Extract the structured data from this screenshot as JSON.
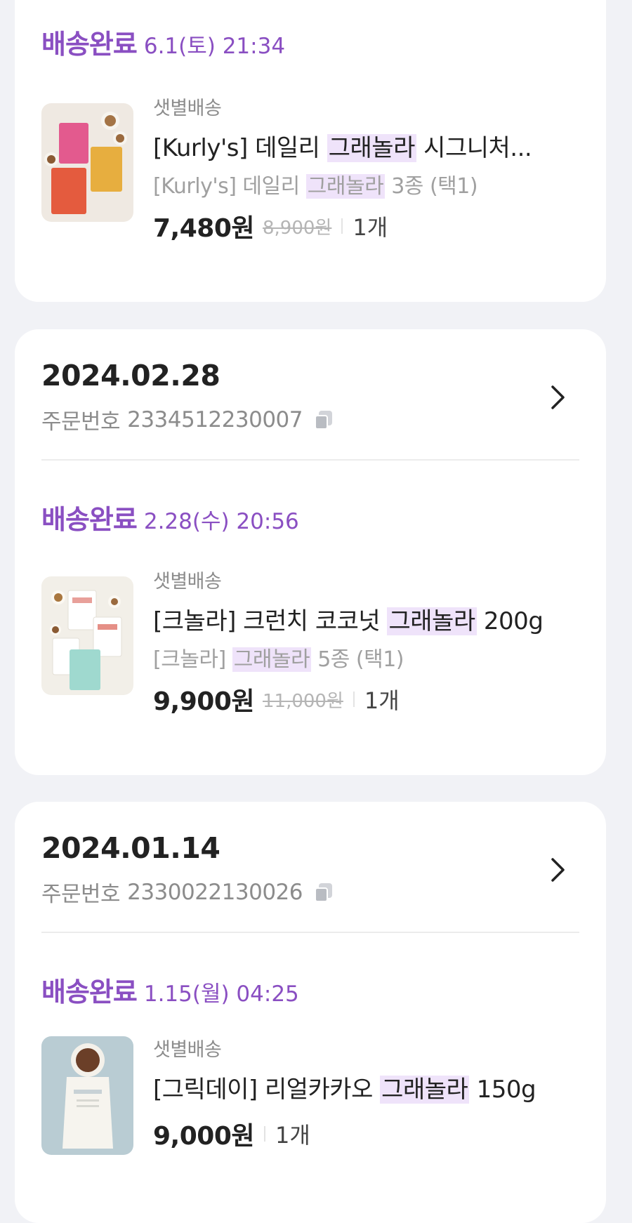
{
  "colors": {
    "accent": "#8a4fc2",
    "highlight": "#efe3fa",
    "background": "#f1f2f6"
  },
  "orders": [
    {
      "status": "배송완료",
      "status_time": "6.1(토) 21:34",
      "item": {
        "shipping": "샛별배송",
        "name_pre": "[Kurly's] 데일리 ",
        "name_hl": "그래놀라",
        "name_post": " 시그니처...",
        "opt_pre": "[Kurly's] 데일리 ",
        "opt_hl": "그래놀라",
        "opt_post": " 3종 (택1)",
        "price": "7,480원",
        "original_price": "8,900원",
        "qty": "1개"
      }
    },
    {
      "date": "2024.02.28",
      "order_label": "주문번호",
      "order_no": "2334512230007",
      "status": "배송완료",
      "status_time": "2.28(수) 20:56",
      "item": {
        "shipping": "샛별배송",
        "name_pre": "[크놀라] 크런치 코코넛 ",
        "name_hl": "그래놀라",
        "name_post": " 200g",
        "opt_pre": "[크놀라] ",
        "opt_hl": "그래놀라",
        "opt_post": " 5종 (택1)",
        "price": "9,900원",
        "original_price": "11,000원",
        "qty": "1개"
      }
    },
    {
      "date": "2024.01.14",
      "order_label": "주문번호",
      "order_no": "2330022130026",
      "status": "배송완료",
      "status_time": "1.15(월) 04:25",
      "item": {
        "shipping": "샛별배송",
        "name_pre": "[그릭데이] 리얼카카오 ",
        "name_hl": "그래놀라",
        "name_post": " 150g",
        "price": "9,000원",
        "qty": "1개"
      }
    }
  ]
}
